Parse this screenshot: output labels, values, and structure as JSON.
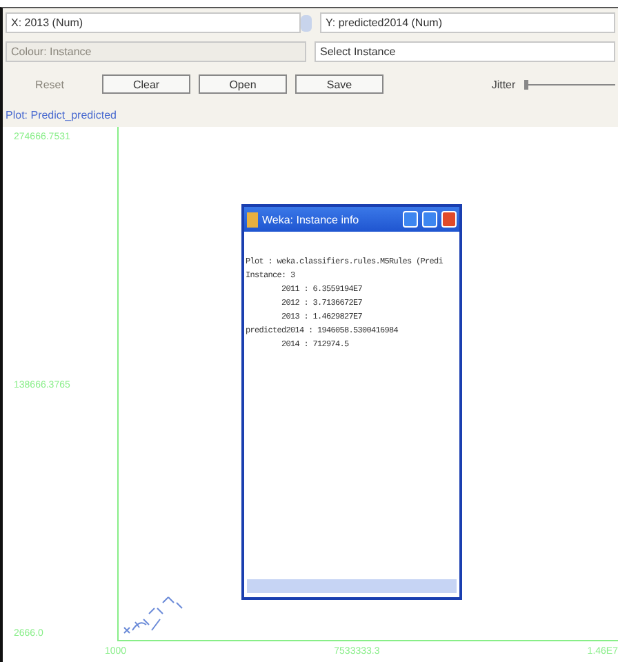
{
  "x_axis_select": {
    "value": "X: 2013 (Num)"
  },
  "y_axis_select": {
    "value": "Y: predicted2014 (Num)"
  },
  "colour_select": {
    "value": "Colour: Instance",
    "disabled": true
  },
  "instance_select": {
    "value": "Select Instance"
  },
  "buttons": [
    {
      "label": "Reset",
      "disabled": true
    },
    {
      "label": "Clear",
      "disabled": false
    },
    {
      "label": "Open",
      "disabled": false
    },
    {
      "label": "Save",
      "disabled": false
    }
  ],
  "jitter": {
    "label": "Jitter",
    "level": 0
  },
  "plot": {
    "title": "Plot: Predict_predicted",
    "y_ticks": [
      "274666.7531",
      "138666.3765",
      "2666.0"
    ],
    "x_ticks": [
      "1000",
      "7533333.3",
      "1.46E7"
    ]
  },
  "dialog": {
    "title": "Weka: Instance info",
    "lines": [
      "Plot : weka.classifiers.rules.M5Rules (Predi",
      "Instance: 3",
      "        2011 : 6.3559194E7",
      "        2012 : 3.7136672E7",
      "        2013 : 1.4629827E7",
      "predicted2014 : 1946058.5300416984",
      "        2014 : 712974.5"
    ]
  }
}
